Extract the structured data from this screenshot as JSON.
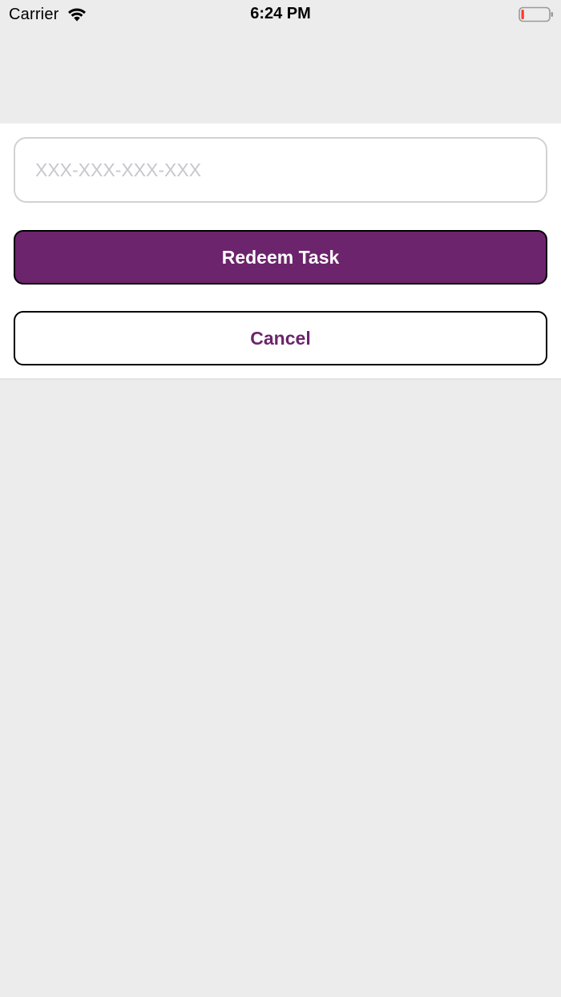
{
  "status_bar": {
    "carrier": "Carrier",
    "time": "6:24 PM",
    "wifi_icon": "wifi-icon",
    "battery_icon": "battery-low-icon",
    "battery_level": 0.1
  },
  "redeem_form": {
    "code_placeholder": "XXX-XXX-XXX-XXX",
    "code_value": "",
    "redeem_label": "Redeem Task",
    "cancel_label": "Cancel"
  },
  "colors": {
    "accent": "#6c246c",
    "background": "#ececec",
    "battery_low": "#ff3b30"
  }
}
